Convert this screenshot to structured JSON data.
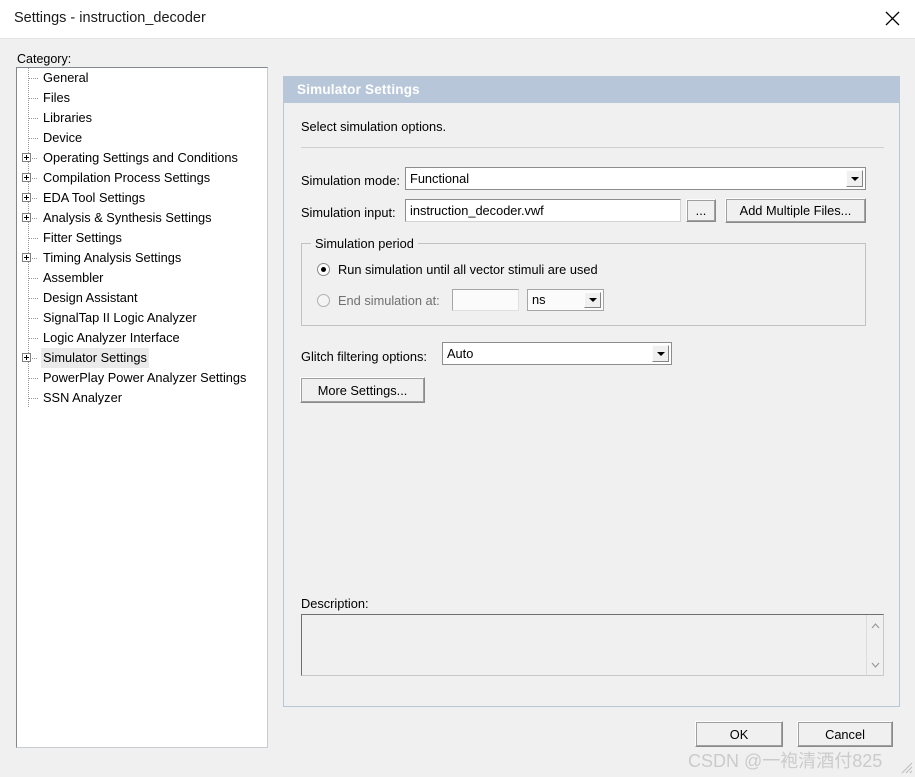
{
  "window": {
    "title": "Settings - instruction_decoder",
    "close_label": "✕"
  },
  "sidebar": {
    "label": "Category:",
    "items": [
      {
        "label": "General",
        "type": "leaf",
        "selected": false
      },
      {
        "label": "Files",
        "type": "leaf",
        "selected": false
      },
      {
        "label": "Libraries",
        "type": "leaf",
        "selected": false
      },
      {
        "label": "Device",
        "type": "leaf",
        "selected": false
      },
      {
        "label": "Operating Settings and Conditions",
        "type": "node",
        "selected": false
      },
      {
        "label": "Compilation Process Settings",
        "type": "node",
        "selected": false
      },
      {
        "label": "EDA Tool Settings",
        "type": "node",
        "selected": false
      },
      {
        "label": "Analysis & Synthesis Settings",
        "type": "node",
        "selected": false
      },
      {
        "label": "Fitter Settings",
        "type": "leaf",
        "selected": false
      },
      {
        "label": "Timing Analysis Settings",
        "type": "node",
        "selected": false
      },
      {
        "label": "Assembler",
        "type": "leaf",
        "selected": false
      },
      {
        "label": "Design Assistant",
        "type": "leaf",
        "selected": false
      },
      {
        "label": "SignalTap II Logic Analyzer",
        "type": "leaf",
        "selected": false
      },
      {
        "label": "Logic Analyzer Interface",
        "type": "leaf",
        "selected": false
      },
      {
        "label": "Simulator Settings",
        "type": "node",
        "selected": true
      },
      {
        "label": "PowerPlay Power Analyzer Settings",
        "type": "leaf",
        "selected": false
      },
      {
        "label": "SSN Analyzer",
        "type": "leaf",
        "selected": false
      }
    ]
  },
  "panel": {
    "header": "Simulator Settings",
    "subtitle": "Select simulation options.",
    "simulation_mode": {
      "label": "Simulation mode:",
      "value": "Functional"
    },
    "simulation_input": {
      "label": "Simulation input:",
      "value": "instruction_decoder.vwf",
      "browse_label": "...",
      "add_multiple_label": "Add Multiple Files..."
    },
    "simulation_period": {
      "legend": "Simulation period",
      "option_run_all": "Run simulation until all vector stimuli are used",
      "option_end_at": "End simulation at:",
      "end_time_value": "",
      "time_unit": "ns"
    },
    "glitch_filtering": {
      "label": "Glitch filtering options:",
      "value": "Auto"
    },
    "more_settings_label": "More Settings...",
    "description": {
      "label": "Description:",
      "value": ""
    }
  },
  "footer": {
    "ok_label": "OK",
    "cancel_label": "Cancel"
  },
  "watermark": {
    "text": "CSDN @一袍清酒付825"
  },
  "colors": {
    "dialog_bg": "#f0f0f0",
    "titlebar_bg": "#ffffff",
    "panel_header_bg": "#b8c6d9",
    "panel_header_fg": "#ffffff",
    "panel_border": "#b9c6d6",
    "field_bg": "#ffffff",
    "selection_bg": "#eaeaea",
    "disabled_fg": "#707070",
    "watermark_fg": "#cbcbcb"
  }
}
